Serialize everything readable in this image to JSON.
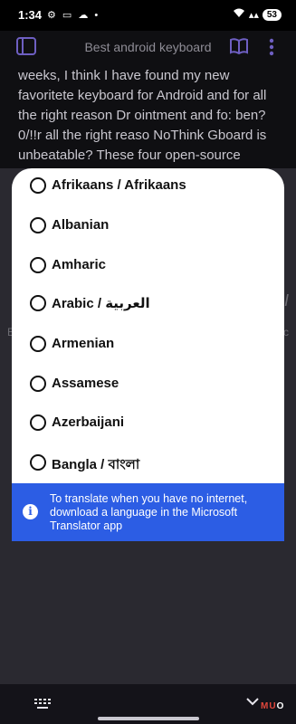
{
  "status_bar": {
    "time": "1:34",
    "notification_icons": "⚙ ▭ ☁ •",
    "signal": "▴▴",
    "battery": "53"
  },
  "app_bar": {
    "title": "Best android keyboard",
    "icons": [
      "sidebar-icon",
      "book-icon",
      "more-icon"
    ]
  },
  "document": {
    "text": "weeks, I think I have found my new favoritete keyboard for Android and for all the right reason Dr ointment and fo: ben? 0/!!r all the right reaso NoThink Gboard is unbeatable? These four open-source Android keyboards might just change"
  },
  "background_ghost": {
    "italic_glyph": "I",
    "left_fragment": "E",
    "right_fragment": "c"
  },
  "language_list": {
    "items": [
      {
        "label": "Afrikaans / Afrikaans"
      },
      {
        "label": "Albanian"
      },
      {
        "label": "Amharic"
      },
      {
        "label": "Arabic / العربية"
      },
      {
        "label": "Armenian"
      },
      {
        "label": "Assamese"
      },
      {
        "label": "Azerbaijani"
      },
      {
        "label": "Bangla / বাংলা"
      }
    ]
  },
  "info_banner": {
    "icon": "info-icon",
    "text": "To translate when you have no internet, download a language in the Microsoft Translator app"
  },
  "nav_bar": {
    "icons": [
      "keyboard-icon",
      "chevron-down-icon"
    ]
  },
  "watermark": {
    "text_a": "MU",
    "text_b": "O"
  },
  "colors": {
    "accent": "#6e5fc2",
    "banner": "#2c5de4",
    "sheet": "#ffffff",
    "background": "#2a2930"
  }
}
